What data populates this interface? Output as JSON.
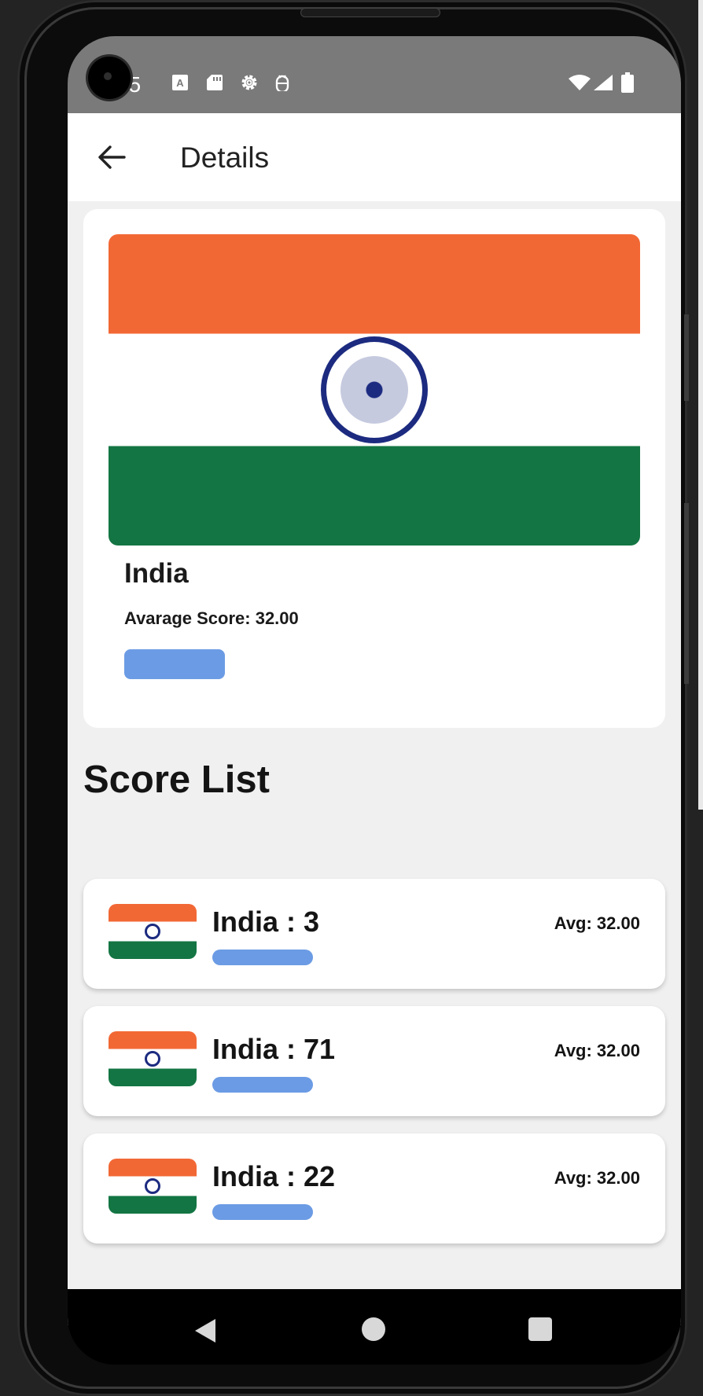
{
  "status_bar": {
    "time": "15",
    "icons": [
      "a-icon",
      "sd-card-icon",
      "settings-gear-icon",
      "android-debug-icon",
      "wifi-icon",
      "signal-icon",
      "battery-icon"
    ]
  },
  "app_bar": {
    "title": "Details",
    "back_icon": "arrow-back-icon"
  },
  "detail_card": {
    "country": "India",
    "average_score_text": "Avarage Score: 32.00",
    "flag_colors": {
      "saffron": "#f26835",
      "white": "#ffffff",
      "green": "#137543",
      "chakra": "#1c2b80"
    }
  },
  "score_list": {
    "title": "Score List",
    "items": [
      {
        "title": "India : 3",
        "avg": "Avg: 32.00"
      },
      {
        "title": "India : 71",
        "avg": "Avg: 32.00"
      },
      {
        "title": "India : 22",
        "avg": "Avg: 32.00"
      }
    ]
  },
  "colors": {
    "progress_bar": "#6b9be4",
    "status_bar_bg": "#7a7a7a",
    "content_bg": "#f0f0f0"
  },
  "nav_bar": {
    "icons": [
      "nav-back-icon",
      "nav-home-icon",
      "nav-recents-icon"
    ]
  }
}
